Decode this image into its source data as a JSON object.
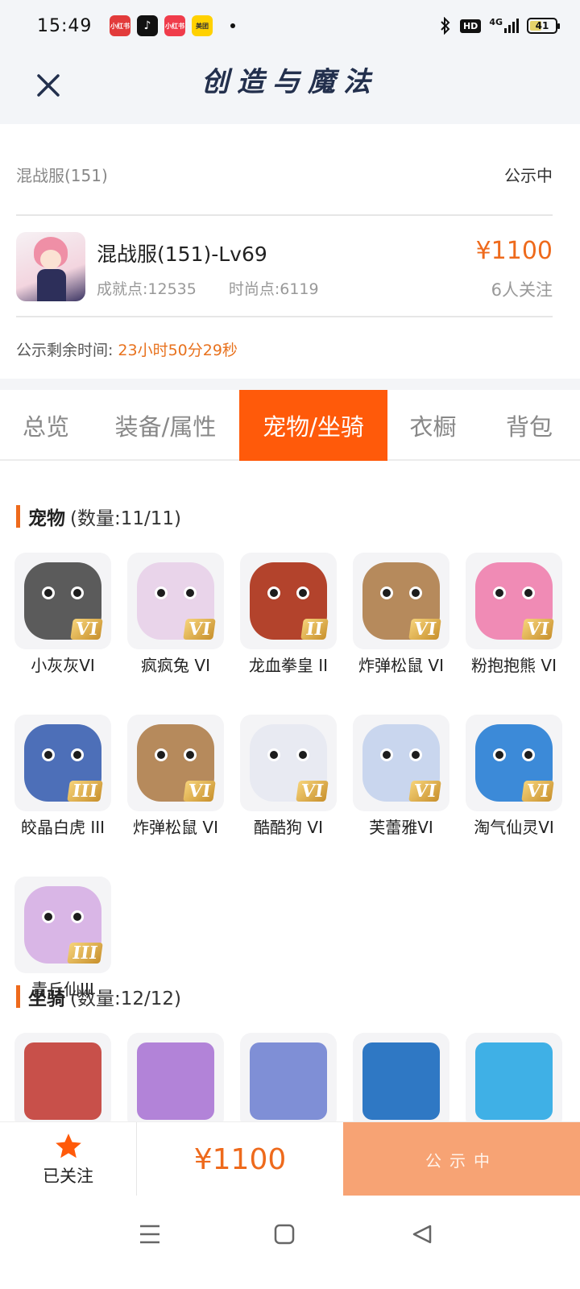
{
  "status_bar": {
    "time": "15:49",
    "apps": [
      {
        "icon": "xiaohongshu-app-icon",
        "text": "小红书",
        "color": "#e23b3b"
      },
      {
        "icon": "tiktok-app-icon",
        "text": "♪",
        "color": "#111111"
      },
      {
        "icon": "xiaohongshu-shop-icon",
        "text": "小红书",
        "color": "#f03c4b"
      },
      {
        "icon": "meituan-app-icon",
        "text": "美团",
        "color": "#ffd100"
      }
    ],
    "hd": "HD",
    "network": "4G",
    "battery": "41"
  },
  "header": {
    "title": "创造与魔法"
  },
  "account": {
    "server": "混战服(151)",
    "status": "公示中",
    "character_title": "混战服(151)-Lv69",
    "achievement": "成就点:12535",
    "fashion": "时尚点:6119",
    "price": "¥1100",
    "followers": "6人关注",
    "remaining_label": "公示剩余时间:",
    "remaining_value": "23小时50分29秒"
  },
  "tabs": [
    {
      "label": "总览",
      "active": false
    },
    {
      "label": "装备/属性",
      "active": false
    },
    {
      "label": "宠物/坐骑",
      "active": true
    },
    {
      "label": "衣橱",
      "active": false
    },
    {
      "label": "背包",
      "active": false
    }
  ],
  "pets_section": {
    "name": "宠物",
    "count": "(数量:11/11)",
    "items": [
      {
        "label": "小灰灰VI",
        "grade": "VI",
        "color": "#5b5b5b"
      },
      {
        "label": "疯疯兔 VI",
        "grade": "VI",
        "color": "#e9d4ea"
      },
      {
        "label": "龙血拳皇 II",
        "grade": "II",
        "color": "#b3432c"
      },
      {
        "label": "炸弹松鼠 VI",
        "grade": "VI",
        "color": "#b68a5c"
      },
      {
        "label": "粉抱抱熊 VI",
        "grade": "VI",
        "color": "#f08bb5"
      },
      {
        "label": "皎晶白虎 III",
        "grade": "III",
        "color": "#4d6fb8"
      },
      {
        "label": "炸弹松鼠 VI",
        "grade": "VI",
        "color": "#b68a5c"
      },
      {
        "label": "酷酷狗 VI",
        "grade": "VI",
        "color": "#e8eaf2"
      },
      {
        "label": "芙蕾雅VI",
        "grade": "VI",
        "color": "#c9d6ee"
      },
      {
        "label": "淘气仙灵VI",
        "grade": "VI",
        "color": "#3c8ad8"
      },
      {
        "label": "青丘仙III",
        "grade": "III",
        "color": "#d9b6e6"
      }
    ]
  },
  "mounts_section": {
    "name": "坐骑",
    "count": "(数量:12/12)",
    "items": [
      {
        "color": "#c8504a"
      },
      {
        "color": "#b283d8"
      },
      {
        "color": "#7f8fd6"
      },
      {
        "color": "#2f78c4"
      },
      {
        "color": "#3fb0e6"
      }
    ]
  },
  "action_bar": {
    "follow_label": "已关注",
    "price": "¥1100",
    "notice_label": "公示中"
  }
}
